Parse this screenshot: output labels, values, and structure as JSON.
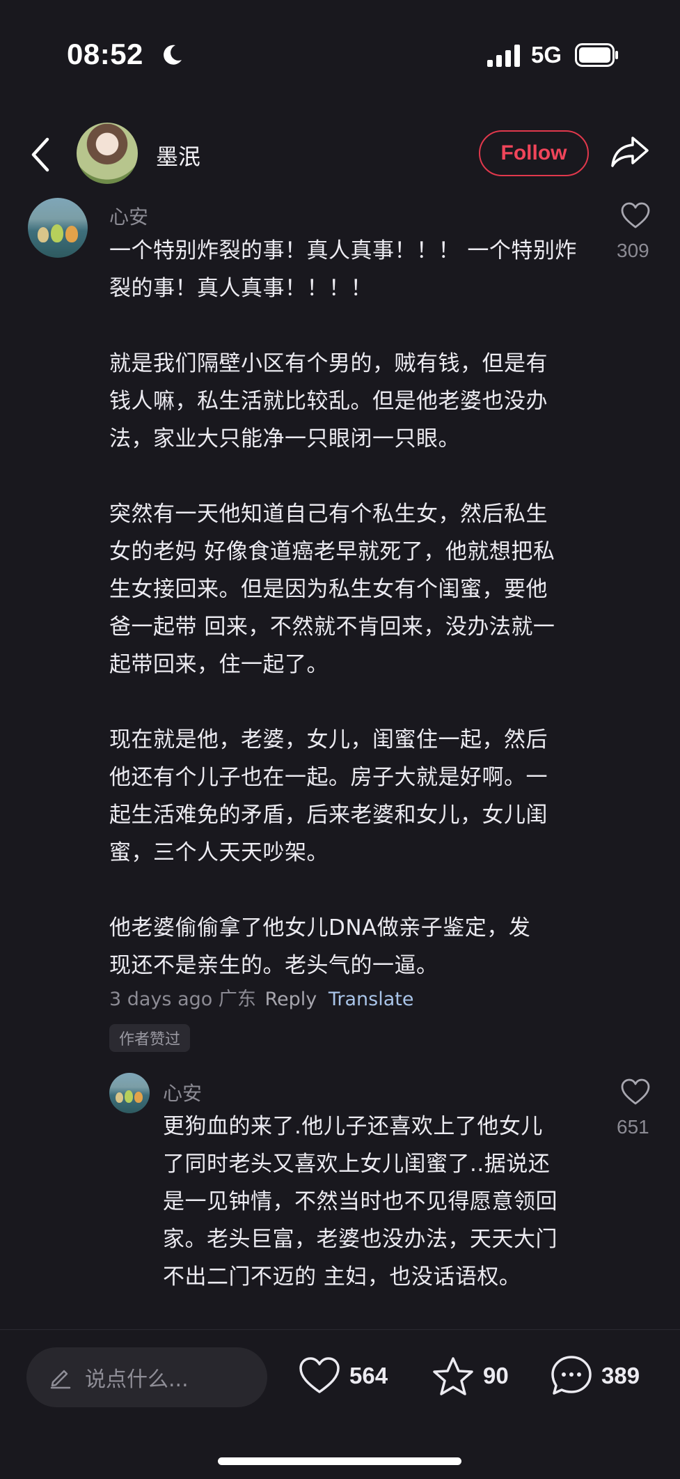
{
  "status_bar": {
    "time": "08:52",
    "network": "5G"
  },
  "header": {
    "author_name": "墨泯",
    "follow_label": "Follow"
  },
  "comments": [
    {
      "user": "心安",
      "likes": "309",
      "text": "一个特别炸裂的事！真人真事！！！ 一个特别炸\n裂的事！真人真事！！！！\n\n就是我们隔壁小区有个男的，贼有钱，但是有\n钱人嘛，私生活就比较乱。但是他老婆也没办\n法，家业大只能净一只眼闭一只眼。\n\n突然有一天他知道自己有个私生女，然后私生\n女的老妈 好像食道癌老早就死了，他就想把私\n生女接回来。但是因为私生女有个闺蜜，要他\n爸一起带 回来，不然就不肯回来，没办法就一\n起带回来，住一起了。\n\n现在就是他，老婆，女儿，闺蜜住一起，然后\n他还有个儿子也在一起。房子大就是好啊。一\n起生活难免的矛盾，后来老婆和女儿，女儿闺\n蜜，三个人天天吵架。\n\n他老婆偷偷拿了他女儿DNA做亲子鉴定，发\n现还不是亲生的。老头气的一逼。",
      "time": "3 days ago",
      "location": "广东",
      "reply_label": "Reply",
      "translate_label": "Translate",
      "badge": "作者赞过"
    },
    {
      "user": "心安",
      "likes": "651",
      "text": "更狗血的来了.他儿子还喜欢上了他女儿\n了同时老头又喜欢上女儿闺蜜了..据说还\n是一见钟情，不然当时也不见得愿意领回\n家。老头巨富，老婆也没办法，天天大门\n不出二门不迈的 主妇，也没话语权。"
    }
  ],
  "bottom_bar": {
    "input_placeholder": "说点什么...",
    "likes": "564",
    "favorites": "90",
    "comments": "389"
  },
  "colors": {
    "accent": "#e0384c",
    "background": "#19181e",
    "translate": "#a9c4e8"
  }
}
